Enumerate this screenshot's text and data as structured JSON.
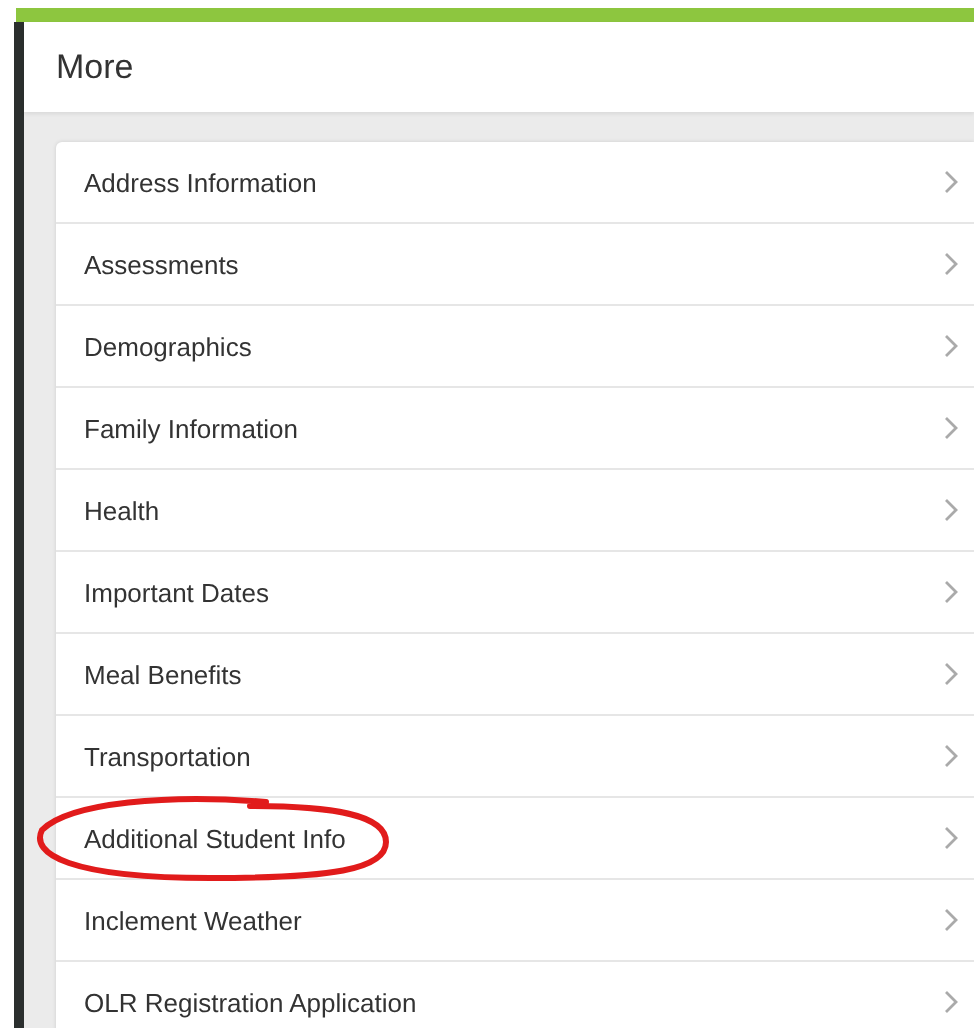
{
  "header": {
    "title": "More"
  },
  "items": [
    {
      "label": "Address Information",
      "circled": false
    },
    {
      "label": "Assessments",
      "circled": false
    },
    {
      "label": "Demographics",
      "circled": false
    },
    {
      "label": "Family Information",
      "circled": false
    },
    {
      "label": "Health",
      "circled": false
    },
    {
      "label": "Important Dates",
      "circled": false
    },
    {
      "label": "Meal Benefits",
      "circled": false
    },
    {
      "label": "Transportation",
      "circled": false
    },
    {
      "label": "Additional Student Info",
      "circled": true
    },
    {
      "label": "Inclement Weather",
      "circled": false
    },
    {
      "label": "OLR Registration Application",
      "circled": false
    }
  ]
}
